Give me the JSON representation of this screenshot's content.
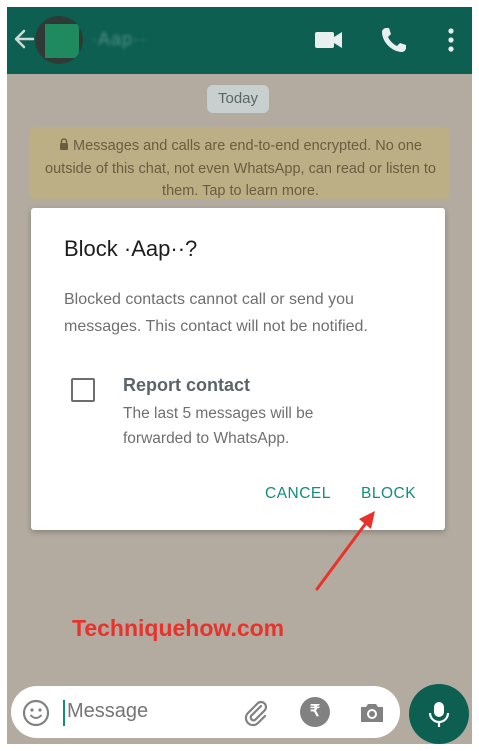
{
  "header": {
    "contact_name": "·Aap··",
    "icons": [
      "back-arrow-icon",
      "video-call-icon",
      "phone-icon",
      "more-vert-icon"
    ]
  },
  "chat": {
    "date_chip": "Today",
    "encryption_notice": "Messages and calls are end-to-end encrypted. No one outside of this chat, not even WhatsApp, can read or listen to them. Tap to learn more."
  },
  "dialog": {
    "title": "Block ·Aap··?",
    "body": "Blocked contacts cannot call or send you messages. This contact will not be notified.",
    "report_title": "Report contact",
    "report_desc": "The last 5 messages will be forwarded to WhatsApp.",
    "report_checked": false,
    "cancel_label": "CANCEL",
    "block_label": "BLOCK"
  },
  "watermark": "Techniquehow.com",
  "composer": {
    "placeholder": "Message",
    "icons": [
      "emoji-icon",
      "attach-icon",
      "rupee-icon",
      "camera-icon",
      "mic-icon"
    ]
  },
  "colors": {
    "header": "#0d5f52",
    "accent": "#128c7e",
    "arrow": "#e8322b",
    "scrim_bg": "#b3ab9f"
  }
}
